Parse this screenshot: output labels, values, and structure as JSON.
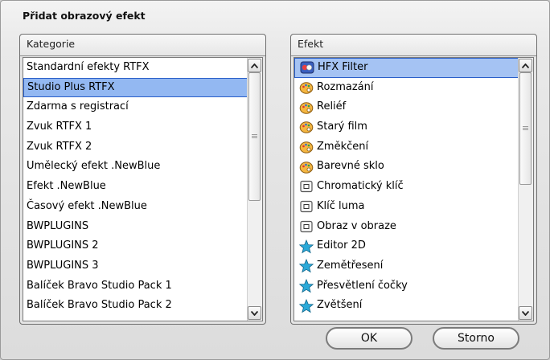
{
  "dialog": {
    "title": "Přidat obrazový efekt"
  },
  "category_panel": {
    "header": "Kategorie",
    "selected_index": 1,
    "items": [
      "Standardní efekty RTFX",
      "Studio Plus RTFX",
      "Zdarma s registrací",
      "Zvuk RTFX 1",
      "Zvuk RTFX 2",
      "Umělecký efekt .NewBlue",
      "Efekt .NewBlue",
      "Časový efekt .NewBlue",
      "BWPLUGINS",
      "BWPLUGINS 2",
      "BWPLUGINS 3",
      "Balíček Bravo Studio Pack 1",
      "Balíček Bravo Studio Pack 2"
    ]
  },
  "effect_panel": {
    "header": "Efekt",
    "selected_index": 0,
    "items": [
      {
        "label": "HFX Filter",
        "icon": "hfx-filter-icon"
      },
      {
        "label": "Rozmazání",
        "icon": "palette-icon"
      },
      {
        "label": "Reliéf",
        "icon": "palette-icon"
      },
      {
        "label": "Starý film",
        "icon": "palette-icon"
      },
      {
        "label": "Změkčení",
        "icon": "palette-icon"
      },
      {
        "label": "Barevné sklo",
        "icon": "palette-icon"
      },
      {
        "label": "Chromatický klíč",
        "icon": "picture-in-picture-icon"
      },
      {
        "label": "Klíč luma",
        "icon": "picture-in-picture-icon"
      },
      {
        "label": "Obraz v obraze",
        "icon": "picture-in-picture-icon"
      },
      {
        "label": "Editor 2D",
        "icon": "star-icon"
      },
      {
        "label": "Zemětřesení",
        "icon": "star-icon"
      },
      {
        "label": "Přesvětlení čočky",
        "icon": "star-icon"
      },
      {
        "label": "Zvětšení",
        "icon": "star-icon"
      }
    ]
  },
  "buttons": {
    "ok": "OK",
    "cancel": "Storno"
  },
  "colors": {
    "selection": "#93b8f2",
    "selection_border": "#2a5fc9",
    "star": "#2aa9d8",
    "palette": "#f2b13a"
  }
}
